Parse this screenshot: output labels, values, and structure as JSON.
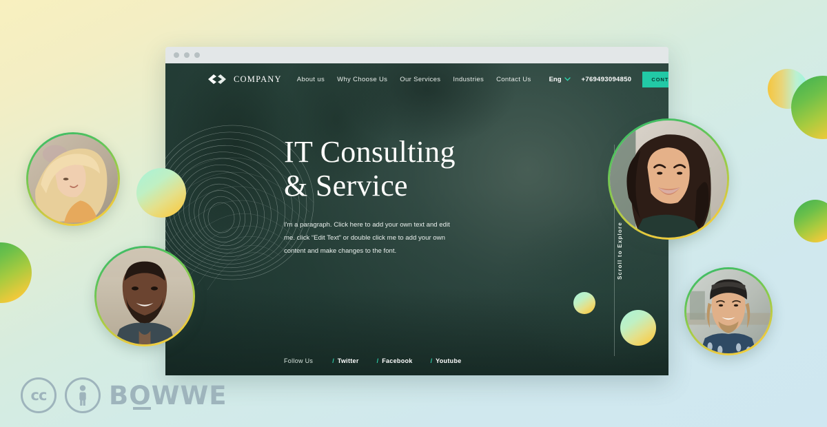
{
  "watermark": {
    "cc_label": "cc",
    "by_label": "by-person-icon",
    "brand": "BOWWE"
  },
  "browser": {
    "dots": [
      "dot-1",
      "dot-2",
      "dot-3"
    ]
  },
  "site": {
    "brand": {
      "logo_icon": "company-ribbon-logo-icon",
      "name": "COMPANY"
    },
    "nav_links": [
      {
        "label": "About us"
      },
      {
        "label": "Why Choose Us"
      },
      {
        "label": "Our Services"
      },
      {
        "label": "Industries"
      },
      {
        "label": "Contact Us"
      }
    ],
    "language": {
      "label": "Eng",
      "chevron_icon": "chevron-down-icon"
    },
    "phone": "+769493094850",
    "cta_label": "CONTACT US",
    "hero": {
      "headline_line1": "IT Consulting",
      "headline_line2": "& Service",
      "paragraph": "I'm a paragraph. Click here to add your own text and edit me. click “Edit Text” or double click me to add your own content and make changes to the font.",
      "scroll_label": "Scroll to Explore"
    },
    "social": {
      "follow_label": "Follow Us",
      "separator": "/",
      "links": [
        {
          "label": "Twitter"
        },
        {
          "label": "Facebook"
        },
        {
          "label": "Youtube"
        }
      ]
    }
  },
  "colors": {
    "accent_teal": "#22c9a6",
    "accent_teal_bright": "#2fd3ad",
    "hero_dark": "#22342e",
    "ring_green": "#36b96a",
    "ring_yellow": "#f5d43e",
    "bg_yellow": "#f8f0bf",
    "bg_blue": "#cfe7f1",
    "watermark_gray": "#9eb4bc"
  },
  "portraits": [
    {
      "name": "portrait-woman-blonde"
    },
    {
      "name": "portrait-man-bearded"
    },
    {
      "name": "portrait-woman-laughing"
    },
    {
      "name": "portrait-man-cap"
    }
  ],
  "spheres": [
    {
      "name": "sphere-left-edge"
    },
    {
      "name": "sphere-mid-left"
    },
    {
      "name": "sphere-hero-small"
    },
    {
      "name": "sphere-hero-large"
    },
    {
      "name": "sphere-right-small"
    },
    {
      "name": "sphere-right-large"
    },
    {
      "name": "sphere-right-lower"
    }
  ]
}
